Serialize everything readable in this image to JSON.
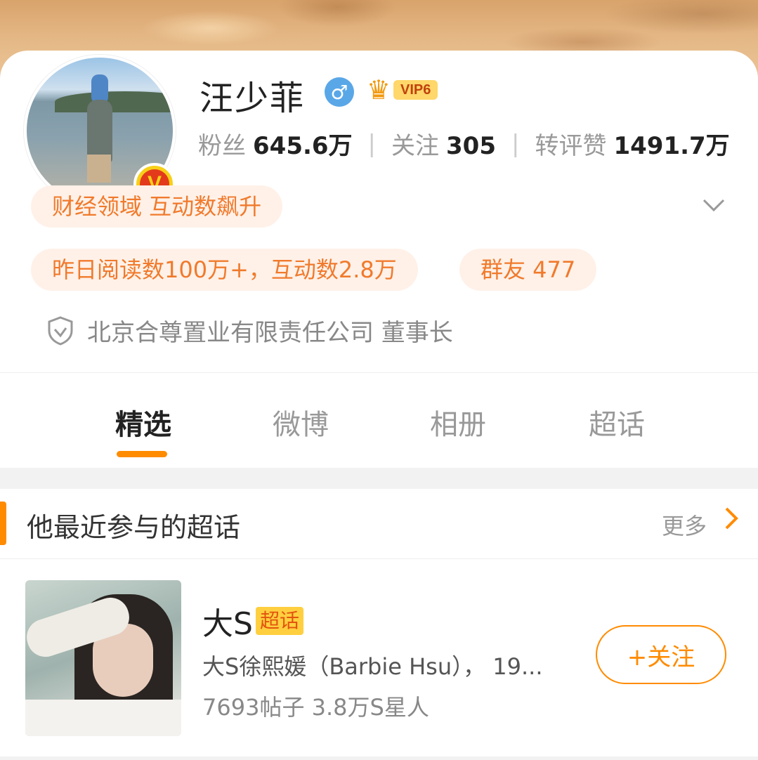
{
  "profile": {
    "name": "汪少菲",
    "gender_symbol": "♂",
    "vip_label": "VIP6",
    "verified_mark": "V"
  },
  "stats": [
    {
      "label": "粉丝",
      "value": "645.6万"
    },
    {
      "label": "关注",
      "value": "305"
    },
    {
      "label": "转评赞",
      "value": "1491.7万"
    }
  ],
  "separator": "|",
  "tags": {
    "domain": "财经领域 互动数飙升",
    "reads": "昨日阅读数100万+，互动数2.8万",
    "group": "群友 477"
  },
  "company": "北京合尊置业有限责任公司 董事长",
  "tabs": [
    {
      "label": "精选",
      "active": true
    },
    {
      "label": "微博",
      "active": false
    },
    {
      "label": "相册",
      "active": false
    },
    {
      "label": "超话",
      "active": false
    }
  ],
  "section": {
    "title": "他最近参与的超话",
    "more": "更多"
  },
  "topic": {
    "name": "大S",
    "badge": "超话",
    "description": "大S徐熙媛（Barbie Hsu）， 19...",
    "meta": "7693帖子 3.8万S星人",
    "follow_label": "+关注"
  },
  "colors": {
    "accent": "#ff8b00",
    "pill_bg": "#fff1e8",
    "pill_text": "#f07a2c"
  }
}
